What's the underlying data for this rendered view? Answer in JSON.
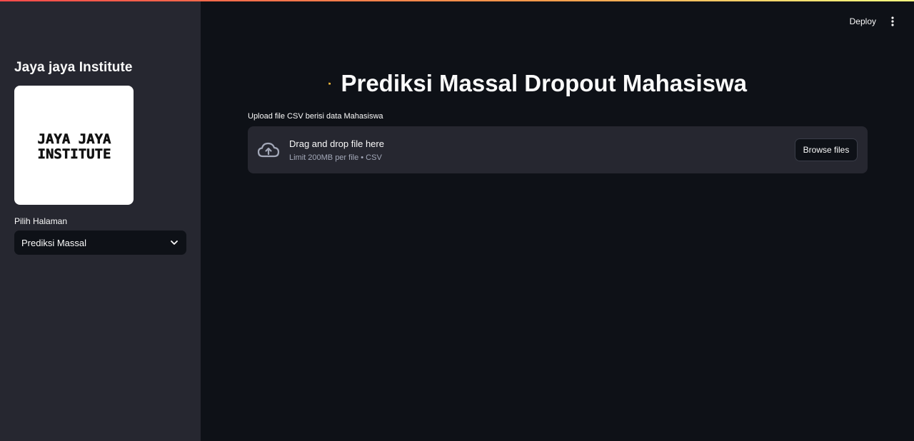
{
  "theme": {
    "background": "#0e1117",
    "sidebar_background": "#262730",
    "text": "#fafafa",
    "muted_text": "#a3a8b8",
    "accent_gradient": [
      "#ff4b4b",
      "#ff9c4b",
      "#fffd80"
    ]
  },
  "sidebar": {
    "title": "Jaya jaya Institute",
    "logo": {
      "icon": "jaya-jaya-institute-logo",
      "line1": "JAYA JAYA",
      "line2": "INSTITUTE"
    },
    "page_select": {
      "label": "Pilih Halaman",
      "selected": "Prediksi Massal",
      "icon": "chevron-down-icon"
    }
  },
  "header": {
    "deploy_label": "Deploy",
    "menu_icon": "vertical-dots-icon"
  },
  "main": {
    "title_icon": "open-folder-icon",
    "title": "Prediksi Massal Dropout Mahasiswa",
    "uploader": {
      "label": "Upload file CSV berisi data Mahasiswa",
      "icon": "cloud-upload-icon",
      "drop_text": "Drag and drop file here",
      "limit_text": "Limit 200MB per file • CSV",
      "browse_label": "Browse files"
    }
  }
}
